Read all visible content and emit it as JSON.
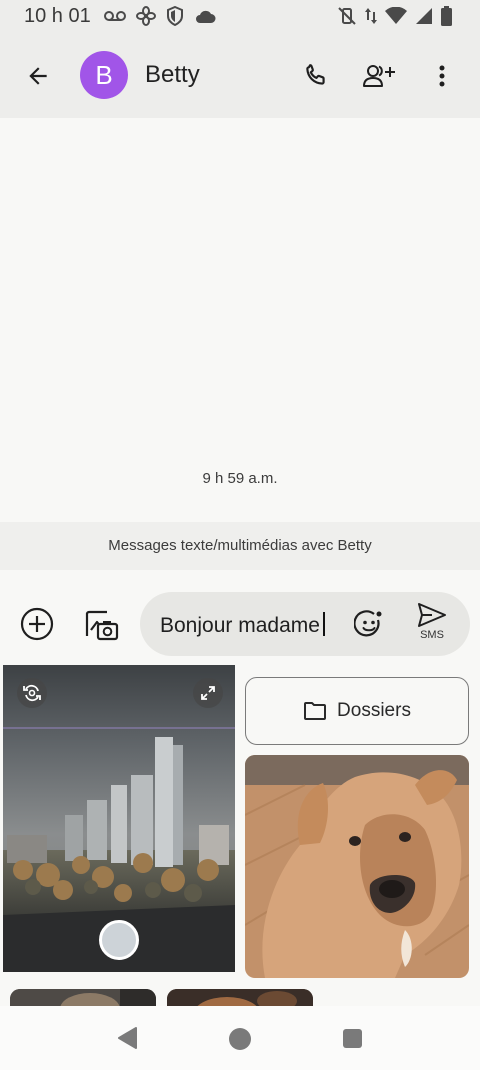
{
  "status_bar": {
    "time": "10 h 01",
    "left_icons": [
      "voicemail-icon",
      "fan-icon",
      "shield-icon",
      "cloud-icon"
    ],
    "right_icons": [
      "vibrate-off-icon",
      "data-arrows-icon",
      "wifi-icon",
      "signal-icon",
      "battery-icon"
    ]
  },
  "header": {
    "avatar_letter": "B",
    "contact_name": "Betty",
    "avatar_color": "#a155e8"
  },
  "conversation": {
    "timestamp": "9 h 59 a.m.",
    "info_banner": "Messages texte/multimédias avec Betty"
  },
  "compose": {
    "text": "Bonjour madame",
    "send_label": "SMS"
  },
  "media": {
    "folders_label": "Dossiers"
  }
}
